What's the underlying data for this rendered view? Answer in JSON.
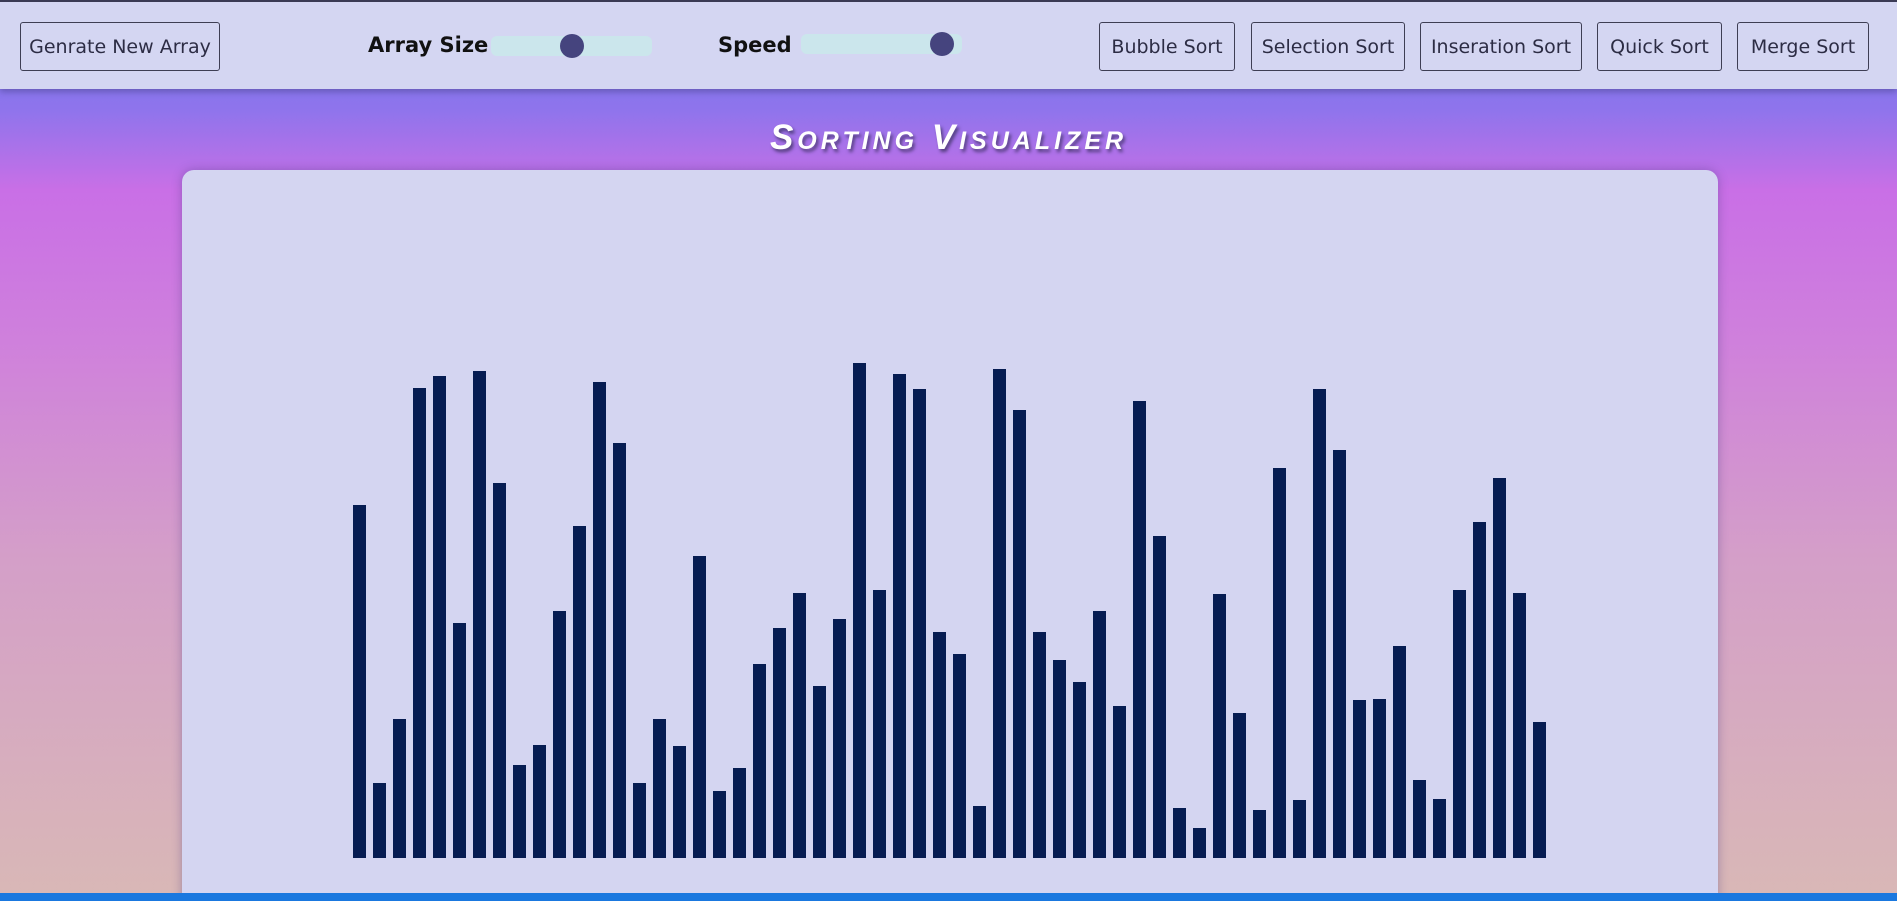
{
  "navbar": {
    "generate_label": "Genrate New Array",
    "array_size_label": "Array Size",
    "speed_label": "Speed",
    "array_size_value": 0.5,
    "speed_value": 0.94,
    "sort_buttons": [
      "Bubble Sort",
      "Selection Sort",
      "Inseration Sort",
      "Quick Sort",
      "Merge Sort"
    ]
  },
  "title": "Sorting Visualizer",
  "colors": {
    "bar": "#061c52",
    "panel": "#d4d5f1",
    "navbar": "#d4d6f2",
    "slider_knob": "#45447e",
    "slider_track": "#cbe6ec"
  },
  "chart_data": {
    "type": "bar",
    "values": [
      353,
      75,
      139,
      470,
      482,
      235,
      487,
      375,
      93,
      113,
      247,
      332,
      476,
      415,
      75,
      139,
      112,
      302,
      67,
      90,
      194,
      230,
      265,
      172,
      239,
      495,
      268,
      484,
      469,
      226,
      204,
      52,
      489,
      448,
      226,
      198,
      176,
      247,
      152,
      457,
      322,
      50,
      30,
      264,
      145,
      48,
      390,
      58,
      469,
      408,
      158,
      159,
      212,
      78,
      59,
      268,
      336,
      380,
      265,
      136
    ]
  }
}
